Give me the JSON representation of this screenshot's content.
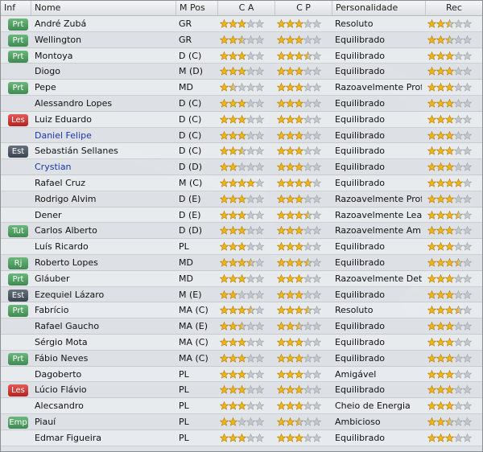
{
  "columns": {
    "inf": "Inf",
    "nome": "Nome",
    "mpos": "M Pos",
    "ca": "C A",
    "cp": "C P",
    "personalidade": "Personalidade",
    "rec": "Rec"
  },
  "colors": {
    "badge_green": "#4f9e62",
    "badge_red": "#cc3a36",
    "badge_dark": "#4a5561",
    "star_fill": "#f2b517",
    "star_empty": "#c4c8cc",
    "link_name": "#1b35a8"
  },
  "players": [
    {
      "badge": "Prt",
      "badge_color": "green",
      "name": "André Zubá",
      "link": false,
      "pos": "GR",
      "ca": 3,
      "cp": 3,
      "personality": "Resoluto",
      "rec": 2.5
    },
    {
      "badge": "Prt",
      "badge_color": "green",
      "name": "Wellington",
      "link": false,
      "pos": "GR",
      "ca": 2.5,
      "cp": 3,
      "personality": "Equilibrado",
      "rec": 2.5
    },
    {
      "badge": "Prt",
      "badge_color": "green",
      "name": "Montoya",
      "link": false,
      "pos": "D (C)",
      "ca": 3,
      "cp": 3.5,
      "personality": "Equilibrado",
      "rec": 3
    },
    {
      "badge": "",
      "badge_color": "",
      "name": "Diogo",
      "link": false,
      "pos": "M (D)",
      "ca": 3,
      "cp": 3,
      "personality": "Equilibrado",
      "rec": 3
    },
    {
      "badge": "Prt",
      "badge_color": "green",
      "name": "Pepe",
      "link": false,
      "pos": "MD",
      "ca": 1.5,
      "cp": 3,
      "personality": "Razoavelmente Profis...",
      "rec": 3
    },
    {
      "badge": "",
      "badge_color": "",
      "name": "Alessandro Lopes",
      "link": false,
      "pos": "D (C)",
      "ca": 3,
      "cp": 3,
      "personality": "Equilibrado",
      "rec": 3
    },
    {
      "badge": "Les",
      "badge_color": "red",
      "name": "Luiz Eduardo",
      "link": false,
      "pos": "D (C)",
      "ca": 3,
      "cp": 3,
      "personality": "Equilibrado",
      "rec": 3
    },
    {
      "badge": "",
      "badge_color": "",
      "name": "Daniel Felipe",
      "link": true,
      "pos": "D (C)",
      "ca": 3,
      "cp": 3,
      "personality": "Equilibrado",
      "rec": 3
    },
    {
      "badge": "Est",
      "badge_color": "dark",
      "name": "Sebastián Sellanes",
      "link": false,
      "pos": "D (C)",
      "ca": 2.5,
      "cp": 3,
      "personality": "Equilibrado",
      "rec": 3
    },
    {
      "badge": "",
      "badge_color": "",
      "name": "Crystian",
      "link": true,
      "pos": "D (D)",
      "ca": 2,
      "cp": 3,
      "personality": "Equilibrado",
      "rec": 3
    },
    {
      "badge": "",
      "badge_color": "",
      "name": "Rafael Cruz",
      "link": false,
      "pos": "M (C)",
      "ca": 4,
      "cp": 4,
      "personality": "Equilibrado",
      "rec": 4
    },
    {
      "badge": "",
      "badge_color": "",
      "name": "Rodrigo Alvim",
      "link": false,
      "pos": "D (E)",
      "ca": 3,
      "cp": 3,
      "personality": "Razoavelmente Profis...",
      "rec": 3
    },
    {
      "badge": "",
      "badge_color": "",
      "name": "Dener",
      "link": false,
      "pos": "D (E)",
      "ca": 3,
      "cp": 3.5,
      "personality": "Razoavelmente Leal",
      "rec": 3.5
    },
    {
      "badge": "Tut",
      "badge_color": "green",
      "name": "Carlos Alberto",
      "link": false,
      "pos": "D (D)",
      "ca": 3,
      "cp": 3,
      "personality": "Razoavelmente Ambi...",
      "rec": 3
    },
    {
      "badge": "",
      "badge_color": "",
      "name": "Luís Ricardo",
      "link": false,
      "pos": "PL",
      "ca": 3,
      "cp": 3,
      "personality": "Equilibrado",
      "rec": 3
    },
    {
      "badge": "Rj",
      "badge_color": "green",
      "name": "Roberto Lopes",
      "link": false,
      "pos": "MD",
      "ca": 3.5,
      "cp": 3.5,
      "personality": "Equilibrado",
      "rec": 3.5
    },
    {
      "badge": "Prt",
      "badge_color": "green",
      "name": "Gláuber",
      "link": false,
      "pos": "MD",
      "ca": 3,
      "cp": 3,
      "personality": "Razoavelmente Deter...",
      "rec": 3
    },
    {
      "badge": "Est",
      "badge_color": "dark",
      "name": "Ezequiel Lázaro",
      "link": false,
      "pos": "M (E)",
      "ca": 2,
      "cp": 3,
      "personality": "Equilibrado",
      "rec": 3
    },
    {
      "badge": "Prt",
      "badge_color": "green",
      "name": "Fabrício",
      "link": false,
      "pos": "MA (C)",
      "ca": 3.5,
      "cp": 3.5,
      "personality": "Resoluto",
      "rec": 3.5
    },
    {
      "badge": "",
      "badge_color": "",
      "name": "Rafael Gaucho",
      "link": false,
      "pos": "MA (E)",
      "ca": 2.5,
      "cp": 2.5,
      "personality": "Equilibrado",
      "rec": 3
    },
    {
      "badge": "",
      "badge_color": "",
      "name": "Sérgio Mota",
      "link": false,
      "pos": "MA (C)",
      "ca": 3,
      "cp": 3,
      "personality": "Equilibrado",
      "rec": 3
    },
    {
      "badge": "Prt",
      "badge_color": "green",
      "name": "Fábio Neves",
      "link": false,
      "pos": "MA (C)",
      "ca": 3,
      "cp": 3,
      "personality": "Equilibrado",
      "rec": 3
    },
    {
      "badge": "",
      "badge_color": "",
      "name": "Dagoberto",
      "link": false,
      "pos": "PL",
      "ca": 3,
      "cp": 3,
      "personality": "Amigável",
      "rec": 3
    },
    {
      "badge": "Les",
      "badge_color": "red",
      "name": "Lúcio Flávio",
      "link": false,
      "pos": "PL",
      "ca": 3,
      "cp": 3,
      "personality": "Equilibrado",
      "rec": 3
    },
    {
      "badge": "",
      "badge_color": "",
      "name": "Alecsandro",
      "link": false,
      "pos": "PL",
      "ca": 3,
      "cp": 3,
      "personality": "Cheio de Energia",
      "rec": 3
    },
    {
      "badge": "Emp",
      "badge_color": "green",
      "name": "Piauí",
      "link": false,
      "pos": "PL",
      "ca": 2,
      "cp": 2.5,
      "personality": "Ambicioso",
      "rec": 2.5
    },
    {
      "badge": "",
      "badge_color": "",
      "name": "Edmar Figueira",
      "link": false,
      "pos": "PL",
      "ca": 3,
      "cp": 3,
      "personality": "Equilibrado",
      "rec": 3
    }
  ]
}
